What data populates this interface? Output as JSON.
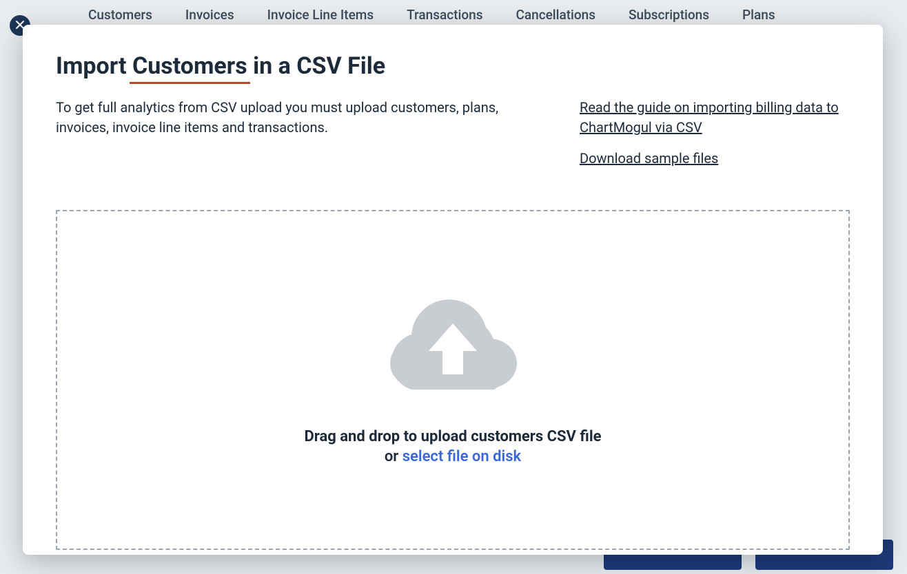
{
  "tabs": [
    "Customers",
    "Invoices",
    "Invoice Line Items",
    "Transactions",
    "Cancellations",
    "Subscriptions",
    "Plans"
  ],
  "modal": {
    "title_prefix": "Import",
    "title_highlight": "Customers",
    "title_suffix": "in a CSV File",
    "intro": "To get full analytics from CSV upload you must upload customers, plans, invoices, invoice line items and transactions.",
    "link_guide": "Read the guide on importing billing data to ChartMogul via CSV",
    "link_sample": "Download sample files",
    "drop_main": "Drag and drop to upload customers CSV file",
    "drop_or": "or ",
    "drop_select": "select file on disk"
  }
}
